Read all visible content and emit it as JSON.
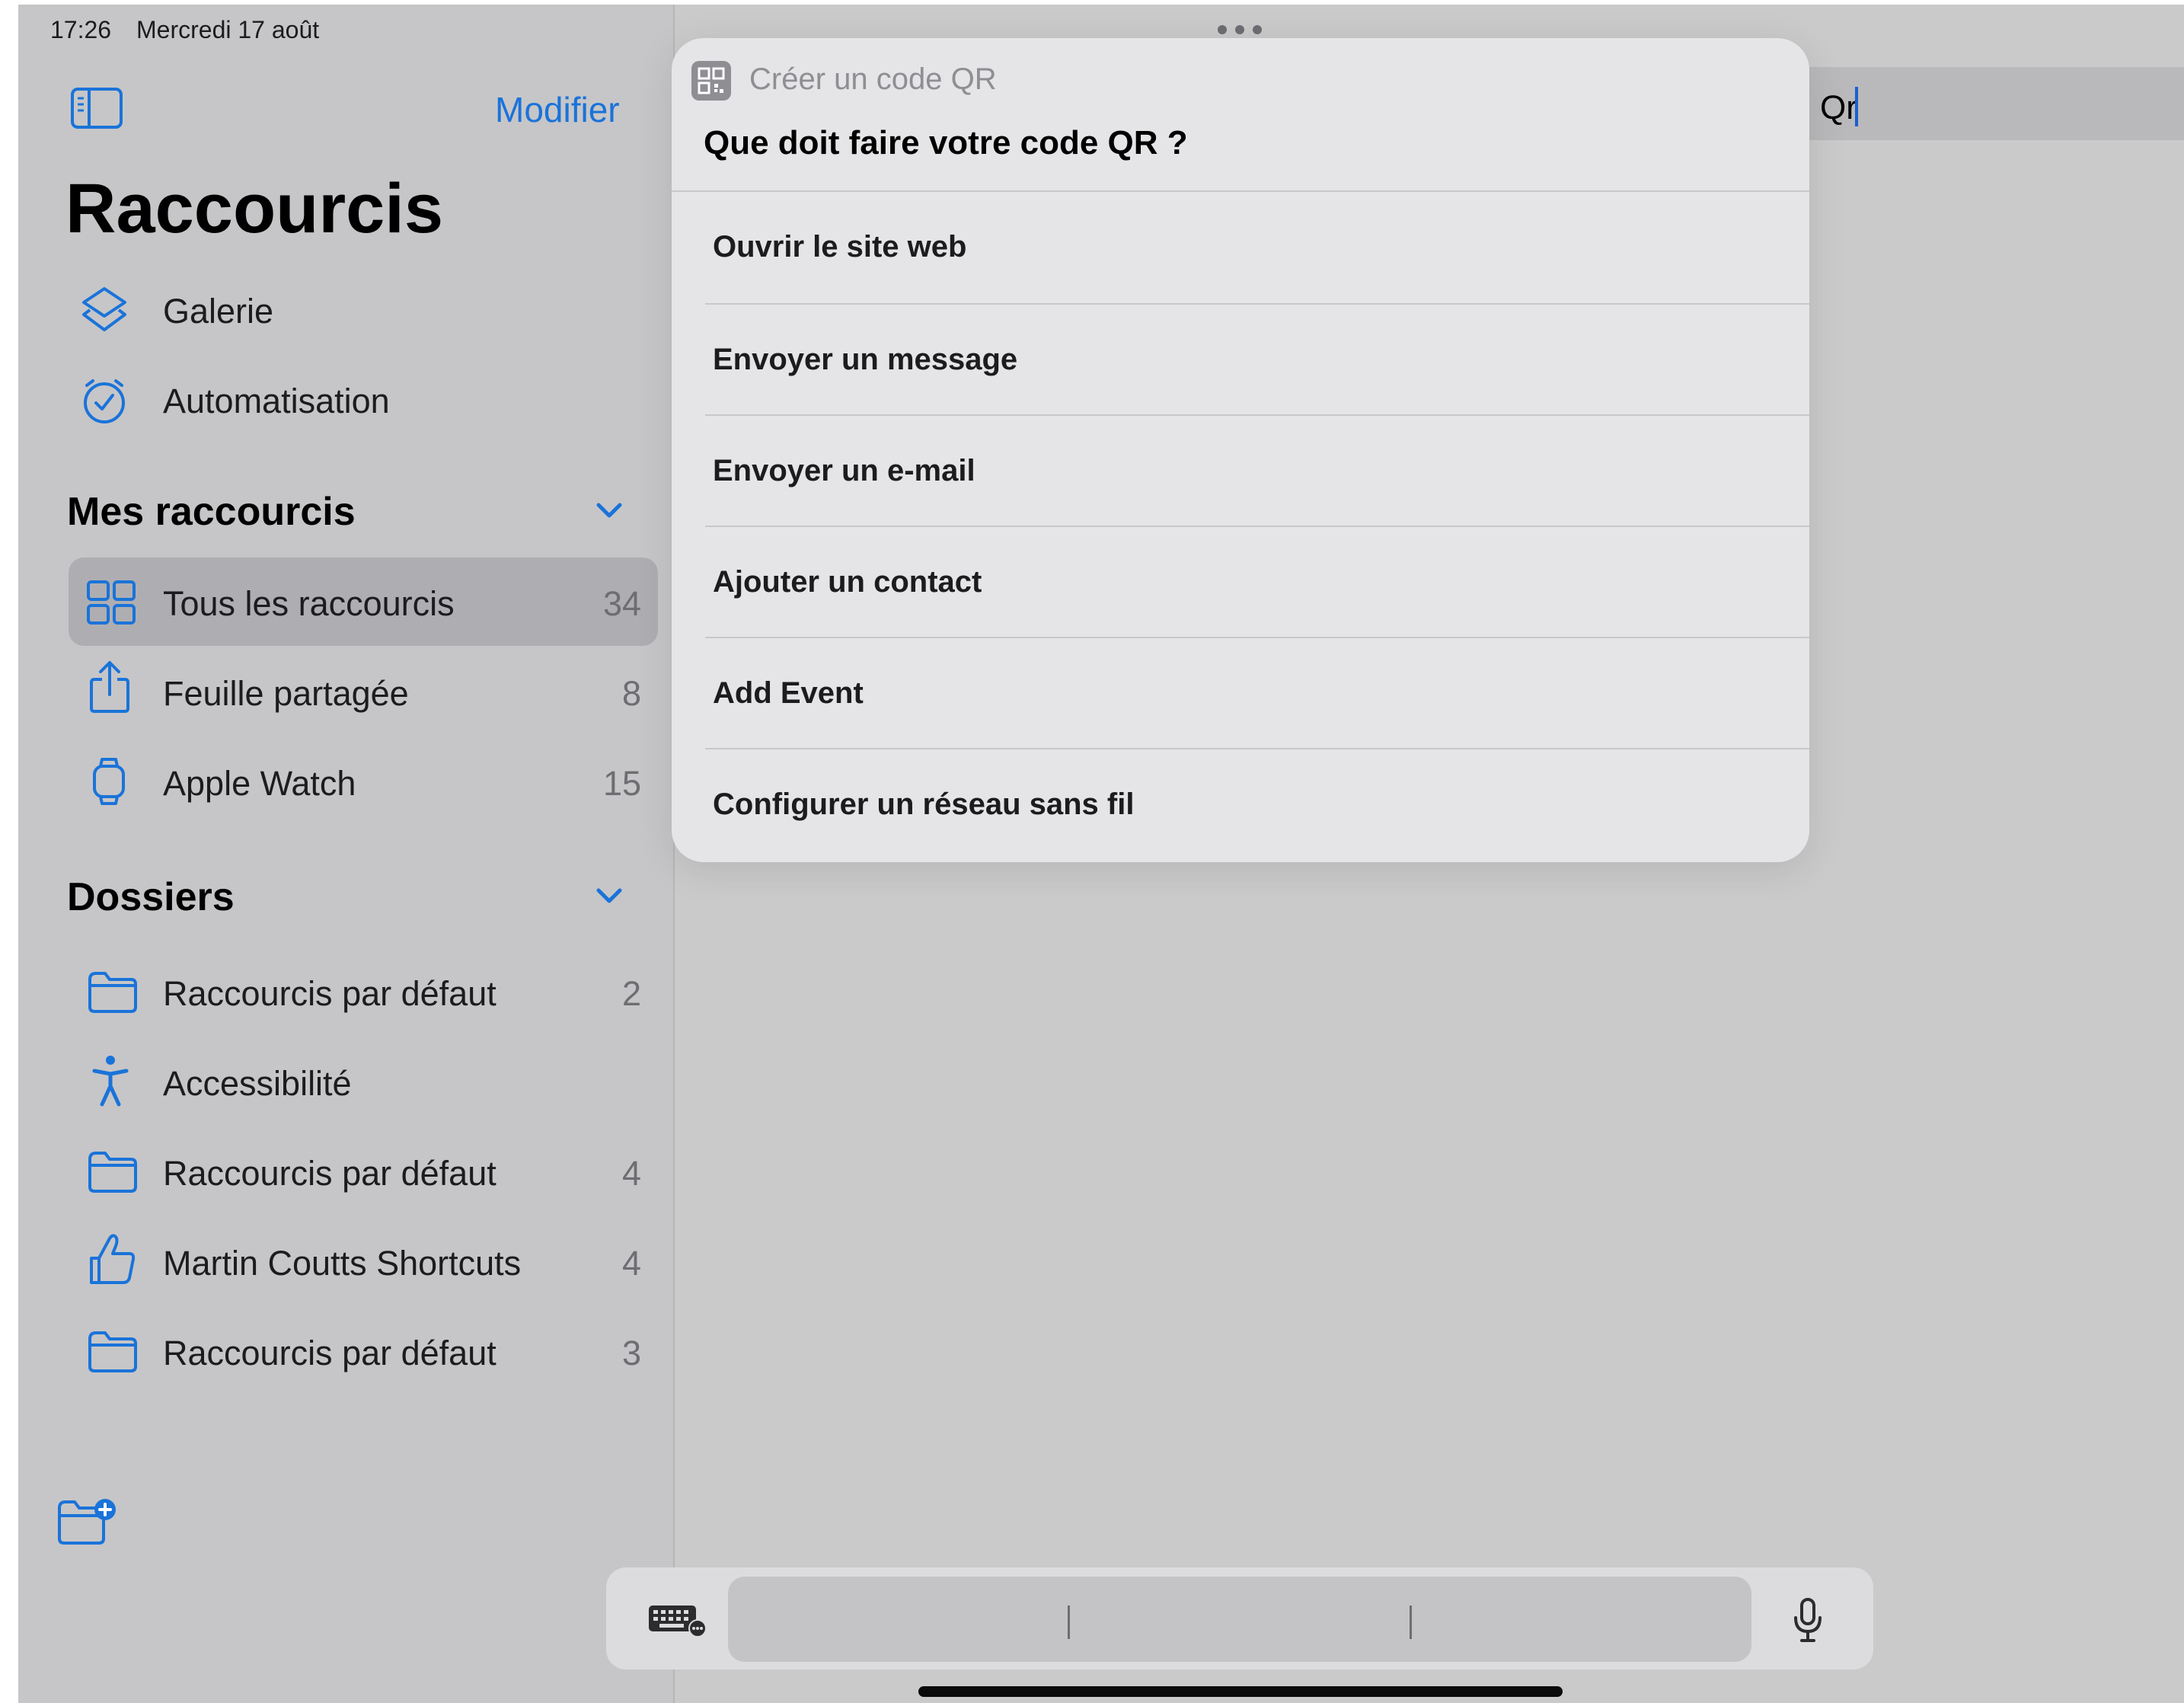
{
  "status_bar": {
    "time": "17:26",
    "date": "Mercredi 17 août"
  },
  "sidebar": {
    "edit_label": "Modifier",
    "title": "Raccourcis",
    "nav_items": [
      {
        "label": "Galerie",
        "icon": "layers-icon"
      },
      {
        "label": "Automatisation",
        "icon": "clock-check-icon"
      }
    ],
    "my_shortcuts": {
      "header": "Mes raccourcis",
      "items": [
        {
          "label": "Tous les raccourcis",
          "count": "34",
          "icon": "grid-icon",
          "selected": true
        },
        {
          "label": "Feuille partagée",
          "count": "8",
          "icon": "share-icon"
        },
        {
          "label": "Apple Watch",
          "count": "15",
          "icon": "watch-icon"
        }
      ]
    },
    "folders": {
      "header": "Dossiers",
      "items": [
        {
          "label": "Raccourcis par défaut",
          "count": "2",
          "icon": "folder-icon"
        },
        {
          "label": "Accessibilité",
          "count": "",
          "icon": "accessibility-icon"
        },
        {
          "label": "Raccourcis par défaut",
          "count": "4",
          "icon": "folder-icon"
        },
        {
          "label": "Martin Coutts Shortcuts",
          "count": "4",
          "icon": "thumbs-up-icon"
        },
        {
          "label": "Raccourcis par défaut",
          "count": "3",
          "icon": "folder-icon"
        }
      ]
    }
  },
  "search": {
    "value": "Qr"
  },
  "popup": {
    "app_name": "Créer un code QR",
    "question": "Que doit faire votre code QR ?",
    "options": [
      "Ouvrir le site web",
      "Envoyer un message",
      "Envoyer un e-mail",
      "Ajouter un contact",
      "Add Event",
      "Configurer un réseau sans fil"
    ]
  },
  "colors": {
    "accent": "#1a73d9",
    "sidebar_bg": "#c6c6c8",
    "main_bg": "#cacaca",
    "popup_bg": "#e5e5e7",
    "selected_row": "#aeaeb2"
  }
}
